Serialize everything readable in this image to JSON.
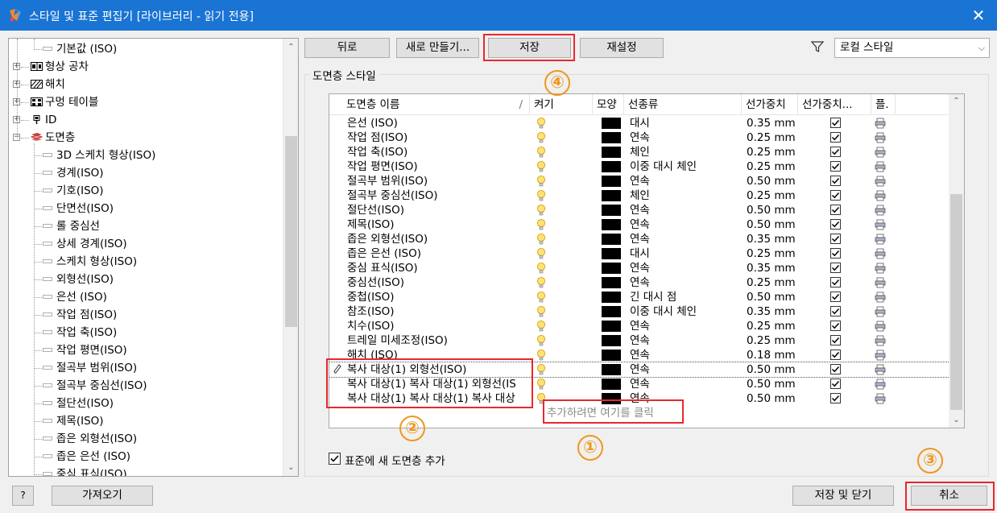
{
  "window": {
    "title": "스타일 및 표준 편집기 [라이브러리 - 읽기 전용]",
    "close_glyph": "✕"
  },
  "tree": {
    "items": [
      {
        "label": "기본값 (ISO)",
        "level": "leaf"
      },
      {
        "label": "형상 공차",
        "level": "node",
        "icon": "feature-control-icon"
      },
      {
        "label": "해치",
        "level": "node",
        "icon": "hatch-icon"
      },
      {
        "label": "구멍 테이블",
        "level": "node",
        "icon": "hole-table-icon"
      },
      {
        "label": "ID",
        "level": "node",
        "icon": "id-icon"
      },
      {
        "label": "도면층",
        "level": "node-open",
        "icon": "layers-icon"
      },
      {
        "label": "3D 스케치 형상(ISO)",
        "level": "leaf"
      },
      {
        "label": "경계(ISO)",
        "level": "leaf"
      },
      {
        "label": "기호(ISO)",
        "level": "leaf"
      },
      {
        "label": "단면선(ISO)",
        "level": "leaf"
      },
      {
        "label": "롤 중심선",
        "level": "leaf"
      },
      {
        "label": "상세 경계(ISO)",
        "level": "leaf"
      },
      {
        "label": "스케치 형상(ISO)",
        "level": "leaf"
      },
      {
        "label": "외형선(ISO)",
        "level": "leaf"
      },
      {
        "label": "은선 (ISO)",
        "level": "leaf"
      },
      {
        "label": "작업 점(ISO)",
        "level": "leaf"
      },
      {
        "label": "작업 축(ISO)",
        "level": "leaf"
      },
      {
        "label": "작업 평면(ISO)",
        "level": "leaf"
      },
      {
        "label": "절곡부 범위(ISO)",
        "level": "leaf"
      },
      {
        "label": "절곡부 중심선(ISO)",
        "level": "leaf"
      },
      {
        "label": "절단선(ISO)",
        "level": "leaf"
      },
      {
        "label": "제목(ISO)",
        "level": "leaf"
      },
      {
        "label": "좁은 외형선(ISO)",
        "level": "leaf"
      },
      {
        "label": "좁은 은선 (ISO)",
        "level": "leaf"
      },
      {
        "label": "중심 표식(ISO)",
        "level": "leaf"
      }
    ]
  },
  "toolbar": {
    "back": "뒤로",
    "new": "새로 만들기...",
    "save": "저장",
    "reset": "재설정",
    "filter": "로컬 스타일"
  },
  "group": {
    "label": "도면층 스타일"
  },
  "grid": {
    "headers": [
      "도면층 이름",
      "켜기",
      "모양",
      "선종류",
      "선가중치",
      "선가중치...",
      "플."
    ],
    "rows": [
      {
        "name": "은선 (ISO)",
        "linetype": "대시",
        "weight": "0.35 mm"
      },
      {
        "name": "작업 점(ISO)",
        "linetype": "연속",
        "weight": "0.25 mm"
      },
      {
        "name": "작업 축(ISO)",
        "linetype": "체인",
        "weight": "0.25 mm"
      },
      {
        "name": "작업 평면(ISO)",
        "linetype": "이중 대시 체인",
        "weight": "0.25 mm"
      },
      {
        "name": "절곡부 범위(ISO)",
        "linetype": "연속",
        "weight": "0.50 mm"
      },
      {
        "name": "절곡부 중심선(ISO)",
        "linetype": "체인",
        "weight": "0.25 mm"
      },
      {
        "name": "절단선(ISO)",
        "linetype": "연속",
        "weight": "0.50 mm"
      },
      {
        "name": "제목(ISO)",
        "linetype": "연속",
        "weight": "0.50 mm"
      },
      {
        "name": "좁은 외형선(ISO)",
        "linetype": "연속",
        "weight": "0.35 mm"
      },
      {
        "name": "좁은 은선 (ISO)",
        "linetype": "대시",
        "weight": "0.25 mm"
      },
      {
        "name": "중심 표식(ISO)",
        "linetype": "연속",
        "weight": "0.35 mm"
      },
      {
        "name": "중심선(ISO)",
        "linetype": "연속",
        "weight": "0.25 mm"
      },
      {
        "name": "중첩(ISO)",
        "linetype": "긴 대시 점",
        "weight": "0.50 mm"
      },
      {
        "name": "참조(ISO)",
        "linetype": "이중 대시 체인",
        "weight": "0.35 mm"
      },
      {
        "name": "치수(ISO)",
        "linetype": "연속",
        "weight": "0.25 mm"
      },
      {
        "name": "트레일 미세조정(ISO)",
        "linetype": "연속",
        "weight": "0.25 mm"
      },
      {
        "name": "해치 (ISO)",
        "linetype": "연속",
        "weight": "0.18 mm"
      },
      {
        "name": "복사 대상(1) 외형선(ISO)",
        "linetype": "연속",
        "weight": "0.50 mm",
        "editing": true
      },
      {
        "name": "복사 대상(1) 복사 대상(1) 외형선(IS",
        "linetype": "연속",
        "weight": "0.50 mm"
      },
      {
        "name": "복사 대상(1) 복사 대상(1) 복사 대상",
        "linetype": "연속",
        "weight": "0.50 mm"
      }
    ],
    "add_hint": "추가하려면 여기를 클릭"
  },
  "std_checkbox": {
    "label": "표준에 새 도면층 추가",
    "checked": true
  },
  "footer": {
    "help": "?",
    "import": "가져오기",
    "save_close": "저장 및 닫기",
    "cancel": "취소"
  },
  "annotations": {
    "one": "①",
    "two": "②",
    "three": "③",
    "four": "④"
  },
  "colors": {
    "titlebar": "#1a74d3",
    "highlight_box": "#e8282e",
    "badge": "#f0961e"
  }
}
